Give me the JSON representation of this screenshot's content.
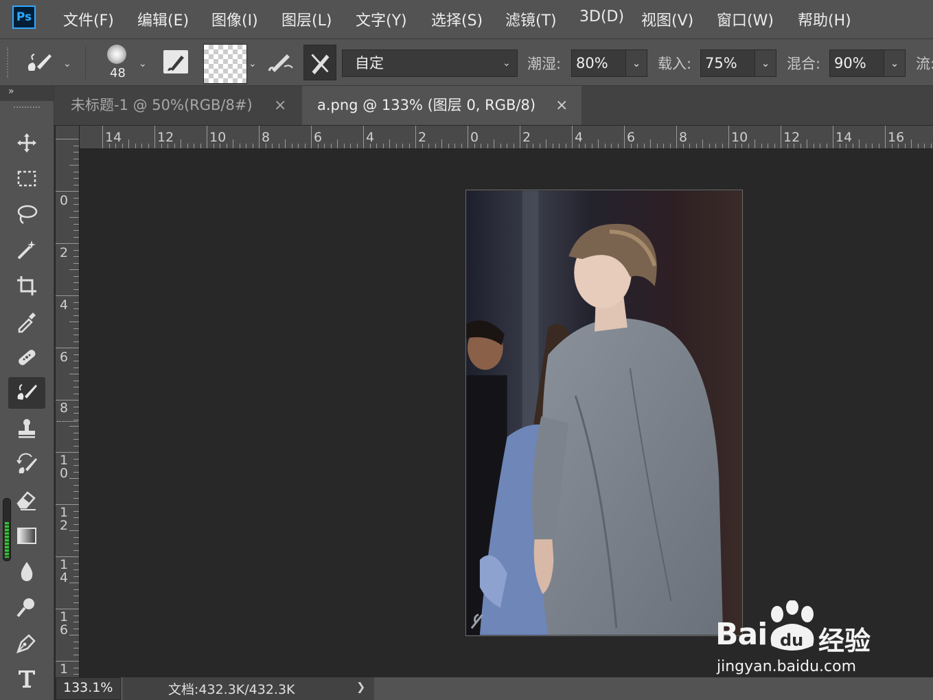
{
  "app": {
    "logo_text": "Ps"
  },
  "menu": [
    {
      "label": "文件(F)"
    },
    {
      "label": "编辑(E)"
    },
    {
      "label": "图像(I)"
    },
    {
      "label": "图层(L)"
    },
    {
      "label": "文字(Y)"
    },
    {
      "label": "选择(S)"
    },
    {
      "label": "滤镜(T)"
    },
    {
      "label": "3D(D)"
    },
    {
      "label": "视图(V)"
    },
    {
      "label": "窗口(W)"
    },
    {
      "label": "帮助(H)"
    }
  ],
  "options": {
    "brush_size": "48",
    "preset_value": "自定",
    "wet_label": "潮湿:",
    "wet_value": "80%",
    "load_label": "载入:",
    "load_value": "75%",
    "mix_label": "混合:",
    "mix_value": "90%",
    "flow_label": "流:"
  },
  "tabs": [
    {
      "label": "未标题-1 @ 50%(RGB/8#)",
      "close": "×",
      "active": false
    },
    {
      "label": "a.png @ 133% (图层 0, RGB/8)",
      "close": "×",
      "active": true
    }
  ],
  "rulers": {
    "horizontal": [
      "14",
      "12",
      "10",
      "8",
      "6",
      "4",
      "2",
      "0",
      "2",
      "4",
      "6",
      "8",
      "10",
      "12",
      "14",
      "16"
    ],
    "vertical": [
      "0",
      "2",
      "4",
      "6",
      "8",
      "10",
      "12",
      "14",
      "16",
      "1"
    ]
  },
  "tools": [
    {
      "icon": "move-icon"
    },
    {
      "icon": "marquee-icon"
    },
    {
      "icon": "lasso-icon"
    },
    {
      "icon": "magic-wand-icon"
    },
    {
      "icon": "crop-icon"
    },
    {
      "icon": "eyedropper-icon"
    },
    {
      "icon": "healing-brush-icon"
    },
    {
      "icon": "mixer-brush-icon",
      "active": true
    },
    {
      "icon": "clone-stamp-icon"
    },
    {
      "icon": "history-brush-icon"
    },
    {
      "icon": "eraser-icon"
    },
    {
      "icon": "gradient-icon"
    },
    {
      "icon": "blur-icon"
    },
    {
      "icon": "dodge-icon"
    },
    {
      "icon": "pen-icon"
    },
    {
      "icon": "type-icon"
    }
  ],
  "status": {
    "zoom": "133.1%",
    "doc_info": "文档:432.3K/432.3K",
    "arrow": "❯"
  },
  "watermark": {
    "brand": "Bai",
    "brand_du": "du",
    "brand_suffix": "经验",
    "url": "jingyan.baidu.com"
  },
  "colors": {
    "accent": "#31a8ff",
    "panel": "#535353",
    "canvas": "#282828"
  }
}
